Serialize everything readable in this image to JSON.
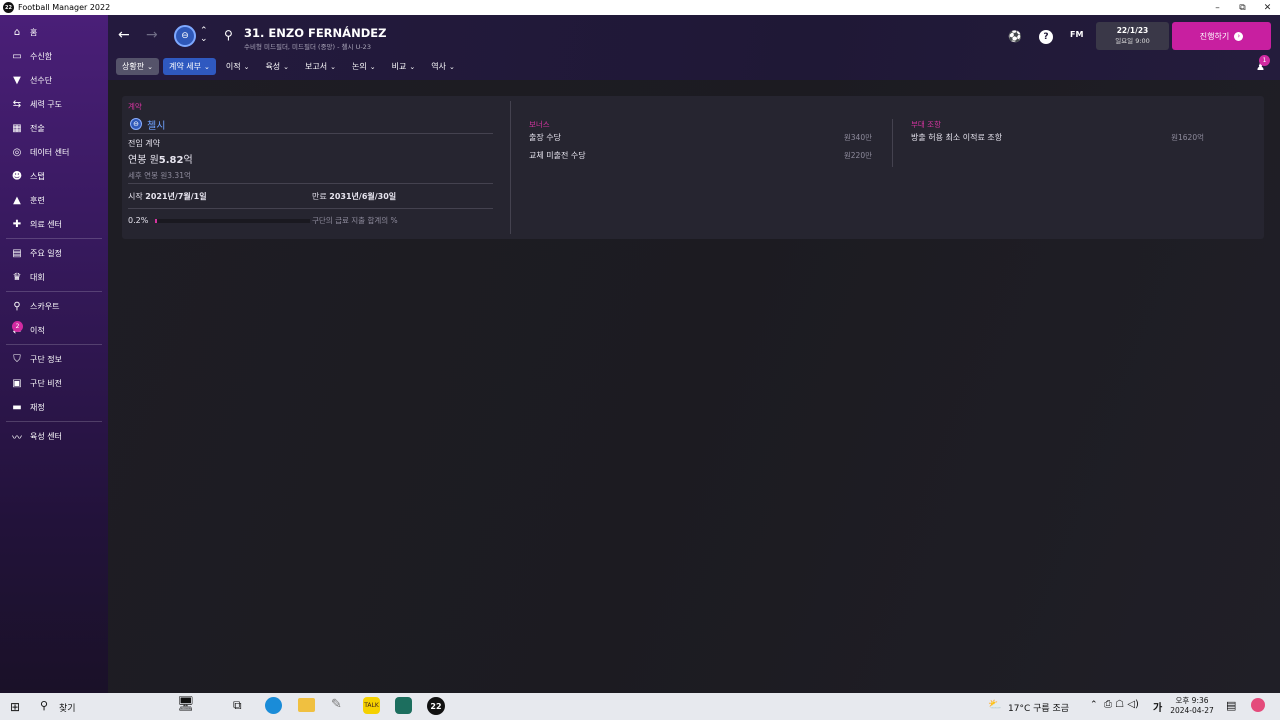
{
  "window": {
    "title": "Football Manager 2022",
    "app_icon": "22",
    "min": "–",
    "max": "⧉",
    "close": "✕"
  },
  "sidebar": {
    "items": [
      {
        "label": "홈",
        "icon": "home-icon"
      },
      {
        "label": "수신함",
        "icon": "inbox-icon"
      },
      {
        "label": "선수단",
        "icon": "shirt-icon"
      },
      {
        "label": "세력 구도",
        "icon": "dynamics-icon"
      },
      {
        "label": "전술",
        "icon": "tactics-icon"
      },
      {
        "label": "데이터 센터",
        "icon": "data-icon"
      },
      {
        "label": "스탭",
        "icon": "staff-icon"
      },
      {
        "label": "훈련",
        "icon": "training-icon"
      },
      {
        "label": "의료 센터",
        "icon": "medical-icon"
      },
      {
        "label": "주요 일정",
        "icon": "calendar-icon"
      },
      {
        "label": "대회",
        "icon": "trophy-icon"
      },
      {
        "label": "스카우트",
        "icon": "scout-icon"
      },
      {
        "label": "이적",
        "icon": "transfer-icon",
        "badge": "2"
      },
      {
        "label": "구단 정보",
        "icon": "shield-icon"
      },
      {
        "label": "구단 비전",
        "icon": "briefcase-icon"
      },
      {
        "label": "재정",
        "icon": "finance-icon"
      },
      {
        "label": "육성 센터",
        "icon": "development-icon"
      }
    ]
  },
  "header": {
    "player_name": "31. ENZO FERNÁNDEZ",
    "player_sub": "수비형 미드필더, 미드필더 (중앙) - 첼시 U-23",
    "fm_label": "FM",
    "date": "22/1/23",
    "date_sub": "일요일 9:00",
    "continue_label": "진행하기",
    "notification_count": "1",
    "tabs": [
      {
        "label": "상황판",
        "state": "open"
      },
      {
        "label": "계약 세부",
        "state": "active"
      },
      {
        "label": "이적"
      },
      {
        "label": "육성"
      },
      {
        "label": "보고서"
      },
      {
        "label": "논의"
      },
      {
        "label": "비교"
      },
      {
        "label": "역사"
      }
    ]
  },
  "contract": {
    "section": "계약",
    "club": "첼시",
    "contract_type": "전임 계약",
    "salary_prefix": "연봉 원",
    "salary_value": "5.82",
    "salary_unit": "억",
    "after_tax": "세후 연봉 원3.31억",
    "start_label": "시작",
    "start_date": "2021년/7월/1일",
    "end_label": "만료",
    "end_date": "2031년/6월/30일",
    "wage_pct": "0.2%",
    "wage_pct_value": 0.2,
    "wage_pct_desc": "구단의 급료 지출 합계의 %"
  },
  "bonus": {
    "section": "보너스",
    "rows": [
      {
        "label": "출장 수당",
        "value": "원340만"
      },
      {
        "label": "교체 미출전 수당",
        "value": "원220만"
      }
    ]
  },
  "clauses": {
    "section": "부대 조항",
    "rows": [
      {
        "label": "방출 허용 최소 이적료 조항",
        "value": "원1620억"
      }
    ]
  },
  "taskbar": {
    "search": "찾기",
    "weather": "17°C  구름 조금",
    "ime": "가",
    "time": "오후 9:36",
    "date": "2024-04-27",
    "fm_icon": "22"
  },
  "colors": {
    "accent": "#c81fa0",
    "sidebar": "#4a1f78",
    "tab_active": "#2f59c0"
  }
}
